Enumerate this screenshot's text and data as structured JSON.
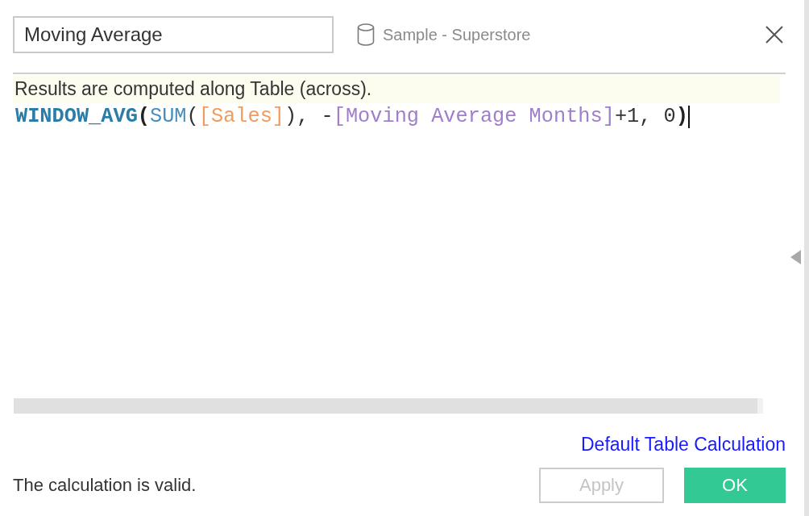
{
  "calculation": {
    "name": "Moving Average",
    "data_source": "Sample - Superstore"
  },
  "editor": {
    "notice": "Results are computed along Table (across).",
    "formula": [
      {
        "text": "WINDOW_AVG",
        "kind": "function"
      },
      {
        "text": "(",
        "kind": "bracket"
      },
      {
        "text": "SUM",
        "kind": "aggregate"
      },
      {
        "text": "(",
        "kind": "plain"
      },
      {
        "text": "[Sales]",
        "kind": "field"
      },
      {
        "text": "), -",
        "kind": "plain"
      },
      {
        "text": "[Moving Average Months]",
        "kind": "parameter"
      },
      {
        "text": "+1, 0",
        "kind": "plain"
      },
      {
        "text": ")",
        "kind": "bracket"
      }
    ]
  },
  "link": "Default Table Calculation",
  "status": "The calculation is valid.",
  "buttons": [
    {
      "label": "Apply",
      "kind": "secondary",
      "disabled": true
    },
    {
      "label": "OK",
      "kind": "primary",
      "disabled": false
    }
  ]
}
